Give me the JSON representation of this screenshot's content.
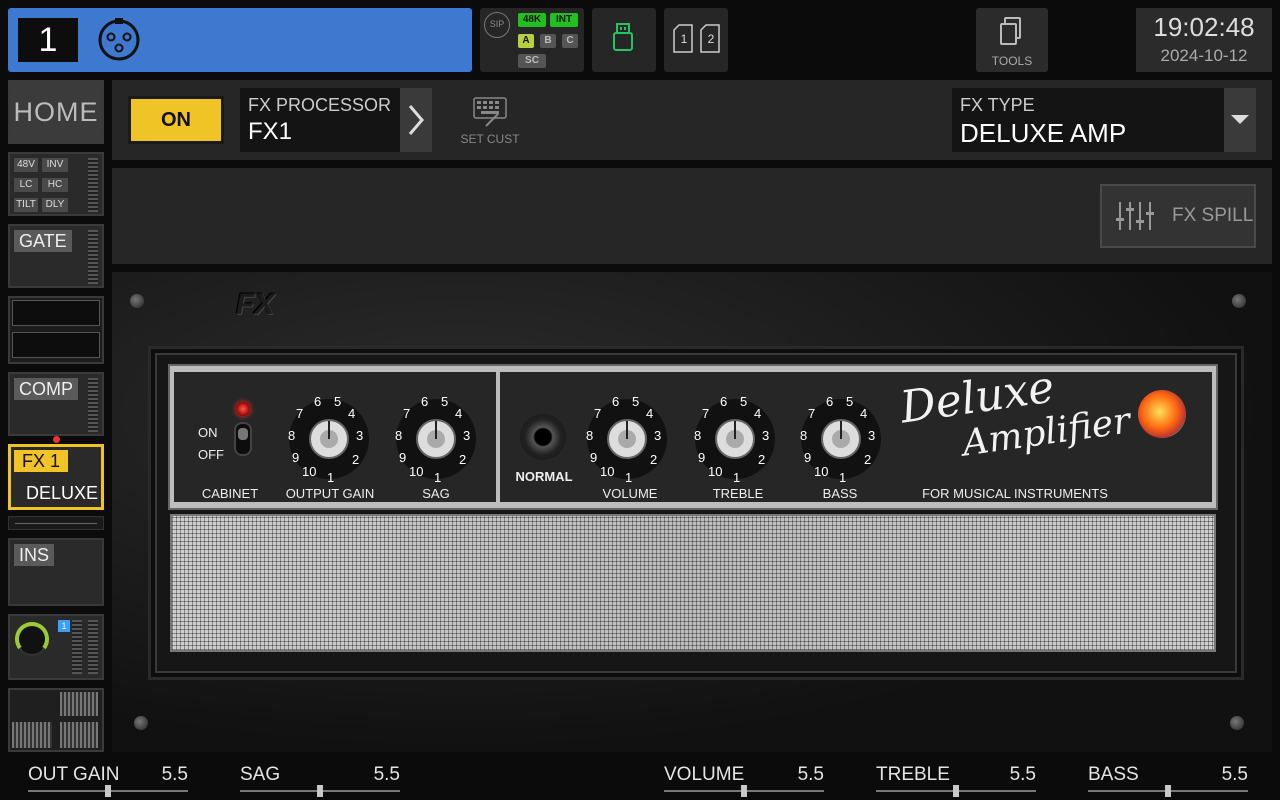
{
  "topbar": {
    "channel_number": "1",
    "sip_label": "SIP",
    "rate_label": "48K",
    "clock_source_label": "INT",
    "bank_a": "A",
    "bank_b": "B",
    "bank_c": "C",
    "sc_label": "SC",
    "card_1": "1",
    "card_2": "2",
    "tools_label": "TOOLS",
    "time": "19:02:48",
    "date": "2024-10-12"
  },
  "sidebar": {
    "home_label": "HOME",
    "preamp_flags": [
      "48V",
      "INV",
      "LC",
      "HC",
      "TILT",
      "DLY"
    ],
    "gate_label": "GATE",
    "comp_label": "COMP",
    "fx_label": "FX 1",
    "fx_value": "DELUXE",
    "ins_label": "INS",
    "send_badge": "1"
  },
  "header": {
    "on_label": "ON",
    "processor_label": "FX PROCESSOR",
    "processor_value": "FX1",
    "set_cust_label": "SET CUST",
    "fx_type_label": "FX TYPE",
    "fx_type_value": "DELUXE AMP"
  },
  "panel": {
    "fx_spill_label": "FX SPILL"
  },
  "amp": {
    "logo": "FX",
    "cabinet_on": "ON",
    "cabinet_off": "OFF",
    "cabinet_label": "CABINET",
    "output_gain_label": "OUTPUT GAIN",
    "sag_label": "SAG",
    "normal_label": "NORMAL",
    "volume_label": "VOLUME",
    "treble_label": "TREBLE",
    "bass_label": "BASS",
    "script_line1": "Deluxe",
    "script_line2": "Amplifier",
    "tagline": "FOR MUSICAL INSTRUMENTS",
    "knob_numbers": [
      "1",
      "2",
      "3",
      "4",
      "5",
      "6",
      "7",
      "8",
      "9",
      "10"
    ]
  },
  "params": [
    {
      "name": "OUT GAIN",
      "value": "5.5"
    },
    {
      "name": "SAG",
      "value": "5.5"
    },
    {
      "name": "VOLUME",
      "value": "5.5"
    },
    {
      "name": "TREBLE",
      "value": "5.5"
    },
    {
      "name": "BASS",
      "value": "5.5"
    }
  ],
  "colors": {
    "channel_strip": "#3e78cf",
    "on_button": "#f0c427",
    "fx_selected": "#f0c427",
    "rate_green": "#20c020",
    "usb_green": "#22c55e"
  }
}
